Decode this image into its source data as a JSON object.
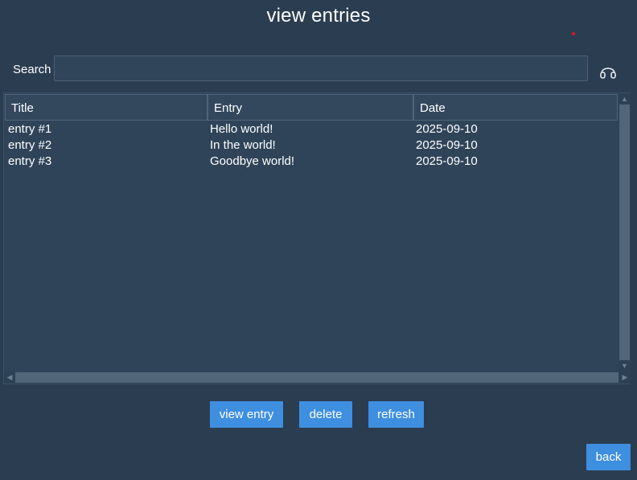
{
  "window": {
    "title": "view entries"
  },
  "search": {
    "label": "Search",
    "value": "",
    "placeholder": "",
    "icon": "headphones-icon"
  },
  "table": {
    "columns": [
      "Title",
      "Entry",
      "Date"
    ],
    "rows": [
      {
        "title": "entry #1",
        "entry": "Hello world!",
        "date": "2025-09-10"
      },
      {
        "title": "entry #2",
        "entry": "In the world!",
        "date": "2025-09-10"
      },
      {
        "title": "entry #3",
        "entry": "Goodbye world!",
        "date": "2025-09-10"
      }
    ]
  },
  "actions": {
    "view_entry": "view entry",
    "delete": "delete",
    "refresh": "refresh",
    "back": "back"
  },
  "colors": {
    "background": "#2b3d51",
    "button": "#3f8fe0",
    "indicator_dot": "#e01b1b"
  }
}
